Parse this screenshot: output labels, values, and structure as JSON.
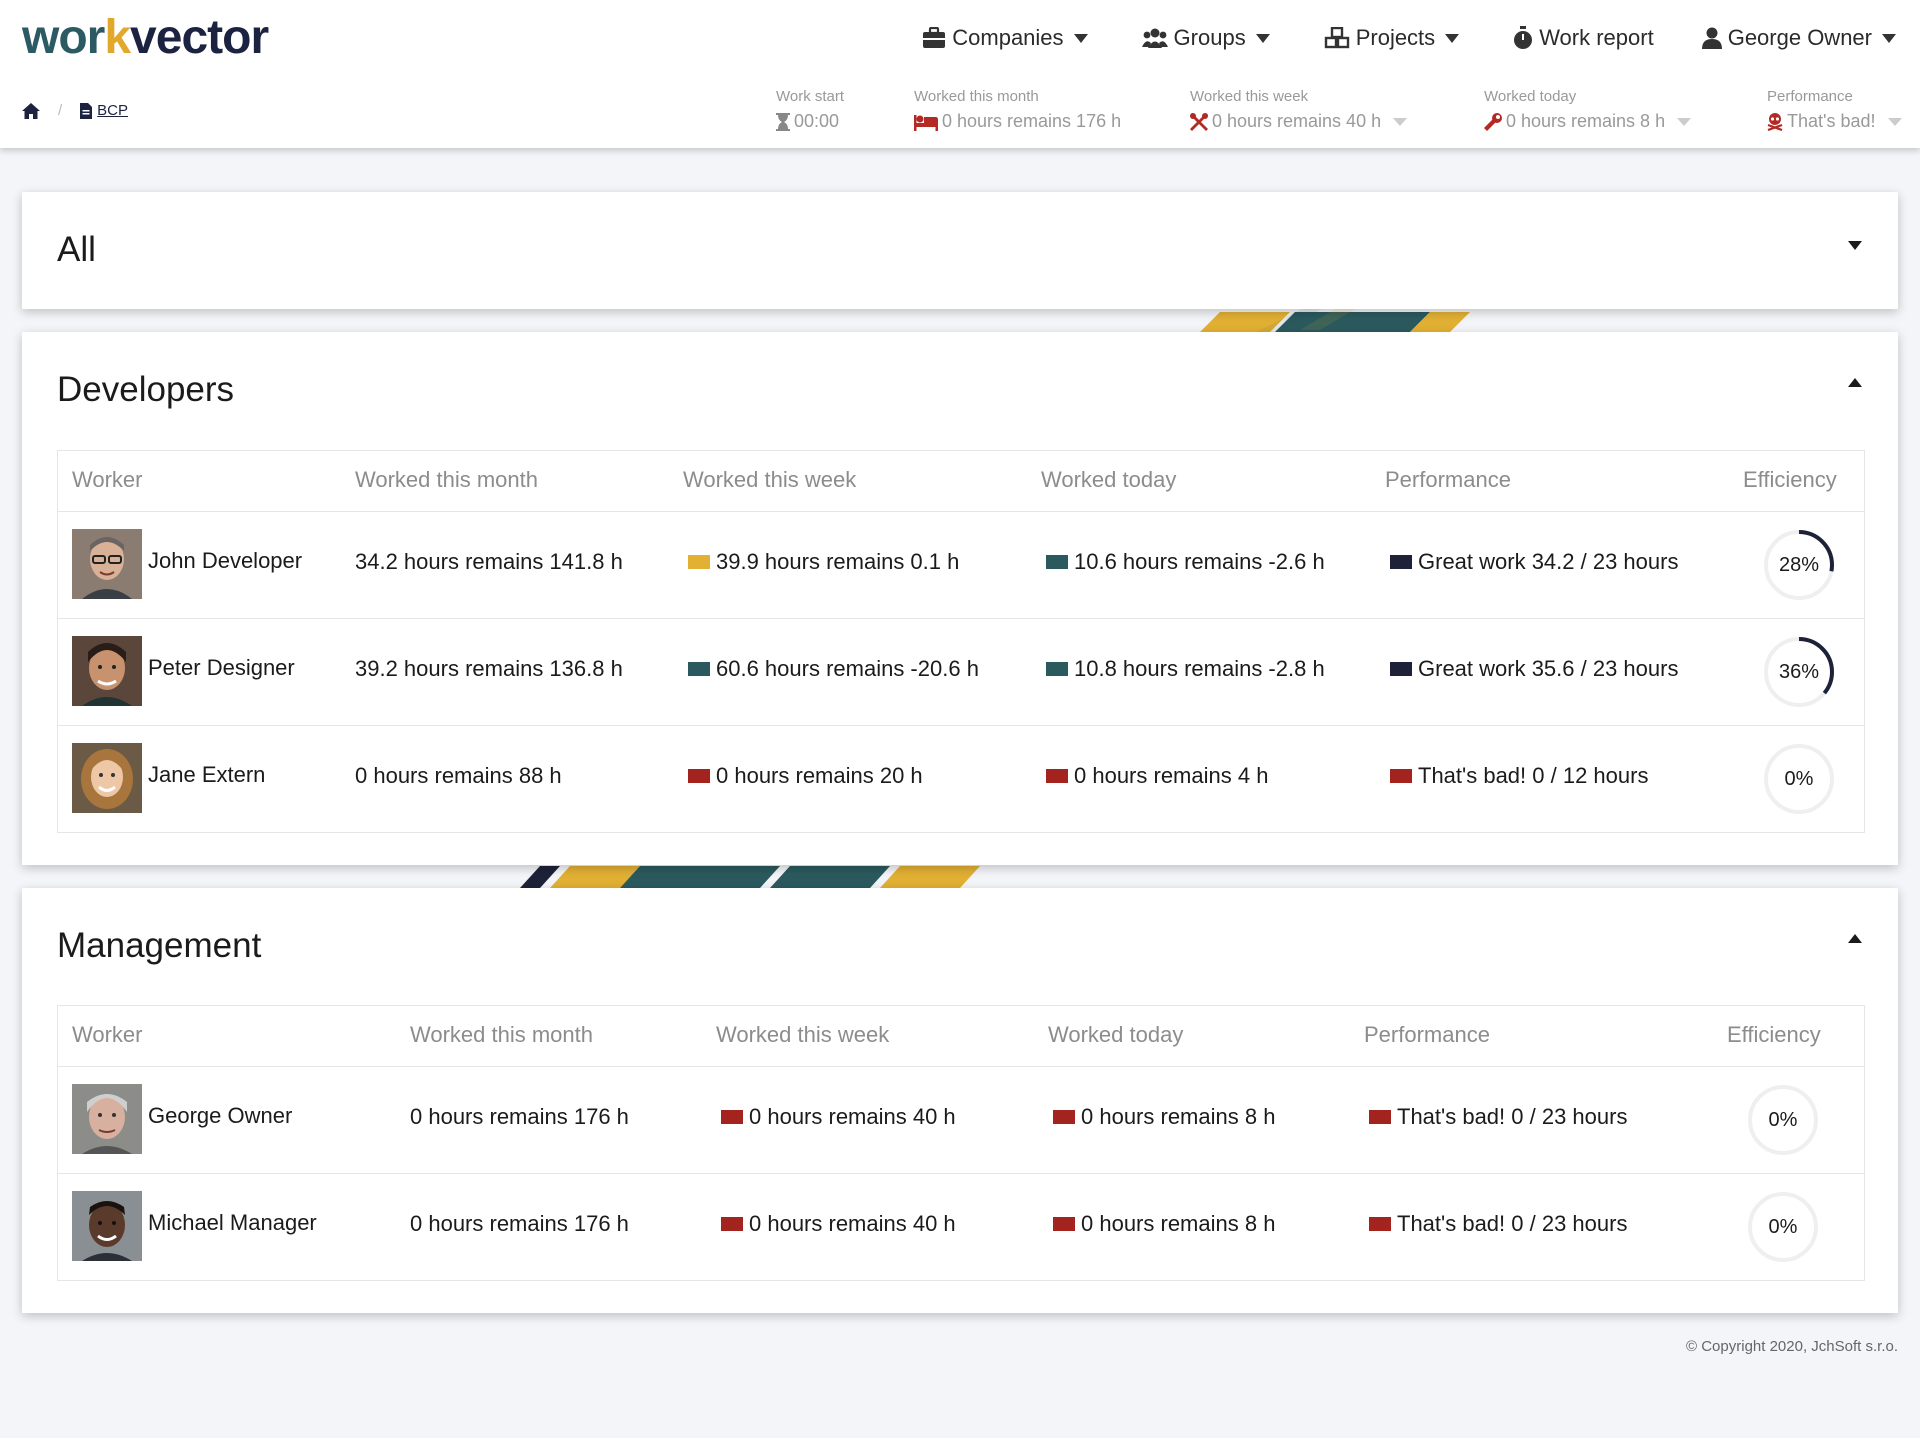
{
  "app": {
    "logo": {
      "part1": "wor",
      "part2": "k",
      "part3": "vector"
    },
    "nav": [
      {
        "label": "Companies",
        "icon": "briefcase-icon",
        "dropdown": true
      },
      {
        "label": "Groups",
        "icon": "users-icon",
        "dropdown": true
      },
      {
        "label": "Projects",
        "icon": "cubes-icon",
        "dropdown": true
      },
      {
        "label": "Work report",
        "icon": "stopwatch-icon",
        "dropdown": false
      },
      {
        "label": "George Owner",
        "icon": "user-icon",
        "dropdown": true
      }
    ],
    "breadcrumb": {
      "home_icon": "home-icon",
      "doc_icon": "file-icon",
      "current": "BCP"
    },
    "stats": {
      "work_start": {
        "label": "Work start",
        "value": "00:00",
        "icon": "hourglass-icon"
      },
      "month": {
        "label": "Worked this month",
        "value": "0 hours remains 176 h",
        "icon": "bed-icon"
      },
      "week": {
        "label": "Worked this week",
        "value": "0 hours remains 40 h",
        "icon": "tools-icon"
      },
      "today": {
        "label": "Worked today",
        "value": "0 hours remains 8 h",
        "icon": "wrench-icon"
      },
      "performance": {
        "label": "Performance",
        "value": "That's bad!",
        "icon": "skull-icon"
      }
    }
  },
  "colors": {
    "yellow": "#e2b033",
    "teal": "#2b5a5e",
    "navy": "#1e2238",
    "red": "#a3241f",
    "stat_icon_red": "#b32923"
  },
  "groups": {
    "all": {
      "title": "All",
      "toggle": "chevron-down-icon"
    },
    "developers": {
      "title": "Developers",
      "toggle": "chevron-up-icon",
      "headers": {
        "worker": "Worker",
        "month": "Worked this month",
        "week": "Worked this week",
        "today": "Worked today",
        "performance": "Performance",
        "efficiency": "Efficiency"
      },
      "rows": [
        {
          "name": "John Developer",
          "month": "34.2 hours remains 141.8 h",
          "week": "39.9 hours remains 0.1 h",
          "week_color": "#e2b033",
          "today": "10.6 hours remains -2.6 h",
          "today_color": "#2b5a5e",
          "performance": "Great work 34.2 / 23 hours",
          "perf_color": "#1e2238",
          "efficiency_label": "28%",
          "efficiency": 0.28
        },
        {
          "name": "Peter Designer",
          "month": "39.2 hours remains 136.8 h",
          "week": "60.6 hours remains -20.6 h",
          "week_color": "#2b5a5e",
          "today": "10.8 hours remains -2.8 h",
          "today_color": "#2b5a5e",
          "performance": "Great work 35.6 / 23 hours",
          "perf_color": "#1e2238",
          "efficiency_label": "36%",
          "efficiency": 0.36
        },
        {
          "name": "Jane Extern",
          "month": "0 hours remains 88 h",
          "week": "0 hours remains 20 h",
          "week_color": "#a3241f",
          "today": "0 hours remains 4 h",
          "today_color": "#a3241f",
          "performance": "That's bad! 0 / 12 hours",
          "perf_color": "#a3241f",
          "efficiency_label": "0%",
          "efficiency": 0
        }
      ]
    },
    "management": {
      "title": "Management",
      "toggle": "chevron-up-icon",
      "headers": {
        "worker": "Worker",
        "month": "Worked this month",
        "week": "Worked this week",
        "today": "Worked today",
        "performance": "Performance",
        "efficiency": "Efficiency"
      },
      "rows": [
        {
          "name": "George Owner",
          "month": "0 hours remains 176 h",
          "week": "0 hours remains 40 h",
          "week_color": "#a3241f",
          "today": "0 hours remains 8 h",
          "today_color": "#a3241f",
          "performance": "That's bad! 0 / 23 hours",
          "perf_color": "#a3241f",
          "efficiency_label": "0%",
          "efficiency": 0
        },
        {
          "name": "Michael Manager",
          "month": "0 hours remains 176 h",
          "week": "0 hours remains 40 h",
          "week_color": "#a3241f",
          "today": "0 hours remains 8 h",
          "today_color": "#a3241f",
          "performance": "That's bad! 0 / 23 hours",
          "perf_color": "#a3241f",
          "efficiency_label": "0%",
          "efficiency": 0
        }
      ]
    }
  },
  "footer": {
    "copyright": "© Copyright 2020, JchSoft s.r.o."
  }
}
